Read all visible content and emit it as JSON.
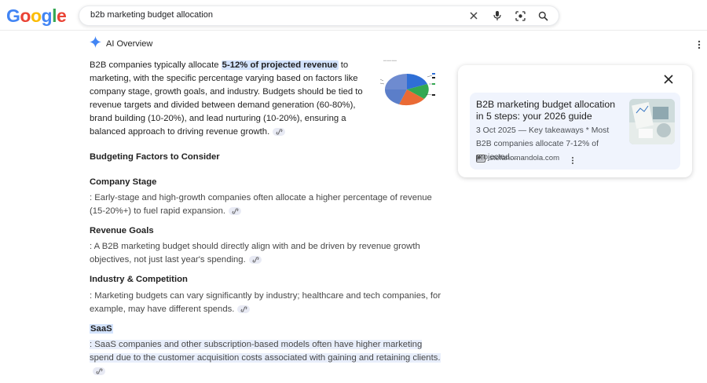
{
  "header": {
    "logo_letters": [
      {
        "ch": "G",
        "color": "#4285f4"
      },
      {
        "ch": "o",
        "color": "#ea4335"
      },
      {
        "ch": "o",
        "color": "#fbbc05"
      },
      {
        "ch": "g",
        "color": "#4285f4"
      },
      {
        "ch": "l",
        "color": "#34a853"
      },
      {
        "ch": "e",
        "color": "#ea4335"
      }
    ],
    "query": "b2b marketing budget allocation",
    "icons": [
      "close-icon",
      "microphone-icon",
      "lens-icon",
      "search-icon"
    ]
  },
  "ai_overview": {
    "title": "AI Overview",
    "summary": {
      "part1": "B2B companies typically allocate ",
      "highlight": "5-12% of projected revenue",
      "part2": " to marketing, with the specific percentage varying based on factors like company stage, growth goals, and industry. Budgets should be tied to revenue targets and divided between demand generation (60-80%), brand building (10-20%), and lead nurturing (10-20%), ensuring a balanced approach to driving revenue growth."
    },
    "section_heading": "Budgeting Factors to Consider",
    "items": [
      {
        "heading": "Company Stage",
        "body": ": Early-stage and high-growth companies often allocate a higher percentage of revenue (15-20%+) to fuel rapid expansion."
      },
      {
        "heading": "Revenue Goals",
        "body": ": A B2B marketing budget should directly align with and be driven by revenue growth objectives, not just last year's spending."
      },
      {
        "heading": "Industry & Competition",
        "body": ": Marketing budgets can vary significantly by industry; healthcare and tech companies, for example, may have different spends."
      },
      {
        "heading": "SaaS",
        "body": ": SaaS companies and other subscription-based models often have higher marketing spend due to the customer acquisition costs associated with gaining and retaining clients."
      }
    ],
    "colors": {
      "highlight": "#d3e3fd",
      "link_chip": "#e8eaf4",
      "sparkle": "#4285f4"
    }
  },
  "source_panel": {
    "card": {
      "title": "B2B marketing budget allocation in 5 steps: your 2026 guide",
      "snippet": "3 Oct 2025 — Key takeaways * Most B2B companies allocate 7-12% of projected…",
      "source": "stefanomandola.com"
    }
  }
}
